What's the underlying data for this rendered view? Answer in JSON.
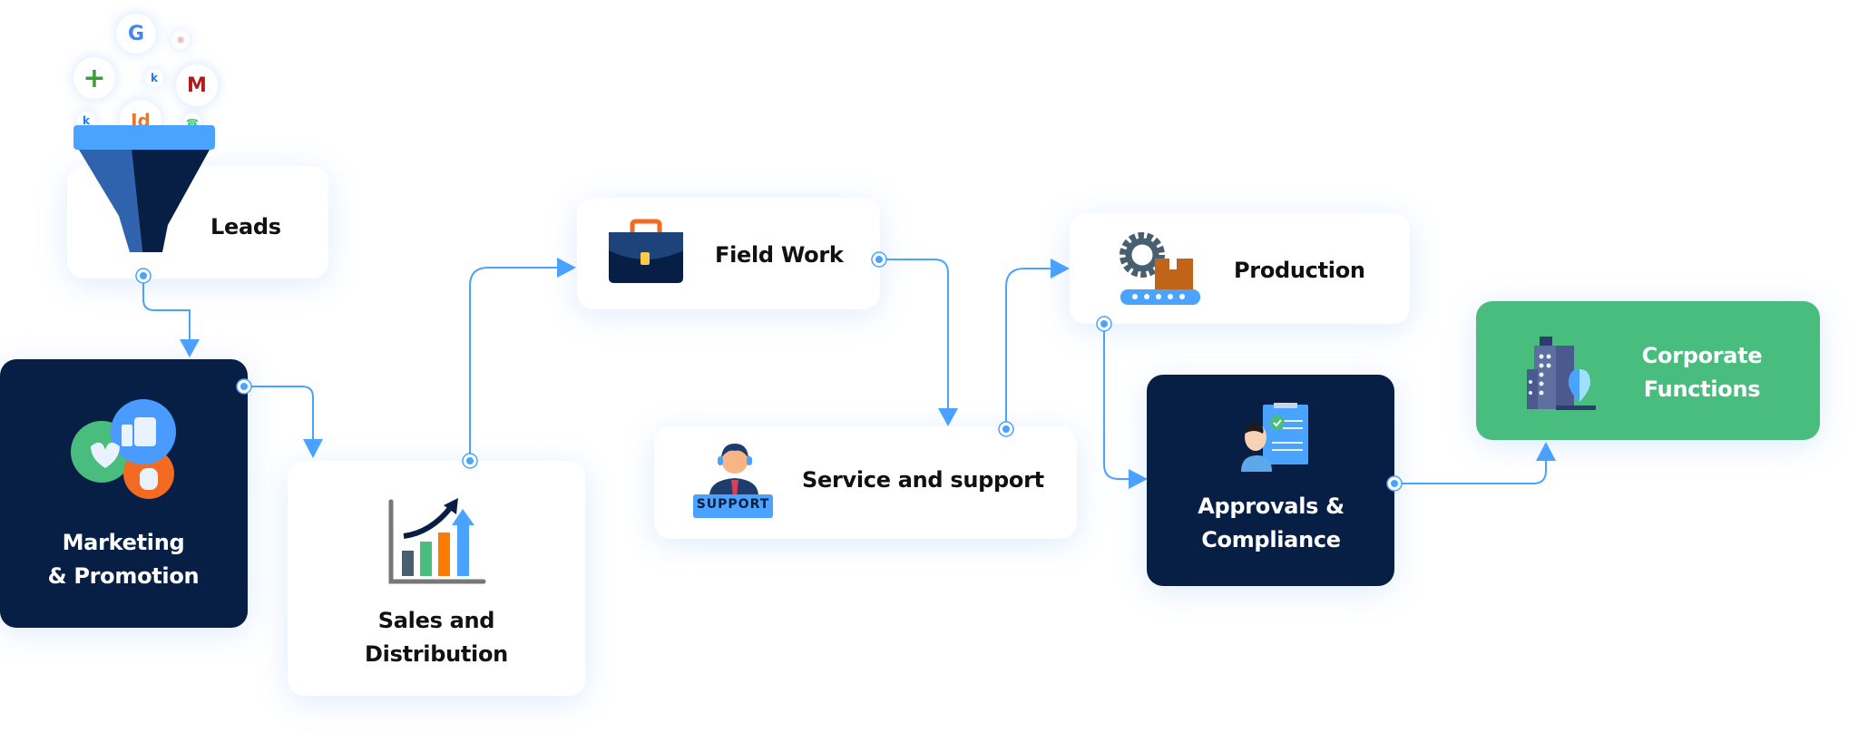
{
  "nodes": {
    "leads": {
      "label": "Leads"
    },
    "marketing": {
      "line1": "Marketing",
      "line2": "& Promotion"
    },
    "sales": {
      "line1": "Sales and",
      "line2": "Distribution"
    },
    "field_work": {
      "label": "Field Work"
    },
    "service": {
      "label": "Service and support",
      "badge": "SUPPORT"
    },
    "production": {
      "label": "Production"
    },
    "approvals": {
      "line1": "Approvals &",
      "line2": "Compliance"
    },
    "corporate": {
      "line1": "Corporate",
      "line2": "Functions"
    }
  },
  "lead_sources": {
    "google": "G",
    "jd": "Jd",
    "m": "M"
  },
  "icons": [
    "funnel-icon",
    "google-icon",
    "indiamart-icon",
    "justdial-icon",
    "whatsapp-icon",
    "webhook-icon",
    "marketing-bubbles-icon",
    "sales-chart-icon",
    "briefcase-icon",
    "support-agent-icon",
    "production-conveyor-icon",
    "approval-checklist-icon",
    "building-icon"
  ],
  "colors": {
    "connector": "#4aa3ff",
    "dark_box": "#081f45",
    "green_box": "#48bd7e",
    "text": "#111111"
  }
}
